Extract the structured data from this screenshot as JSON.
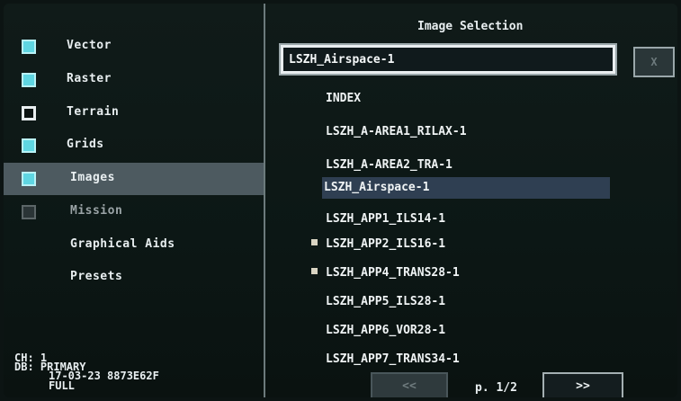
{
  "layers": [
    {
      "label": "Vector",
      "state": "on"
    },
    {
      "label": "Raster",
      "state": "on"
    },
    {
      "label": "Terrain",
      "state": "off"
    },
    {
      "label": "Grids",
      "state": "on"
    },
    {
      "label": "Images",
      "state": "on",
      "selected": true
    },
    {
      "label": "Mission",
      "state": "disabled"
    },
    {
      "label": "Graphical Aids"
    },
    {
      "label": "Presets"
    }
  ],
  "status": {
    "line1": "CH: 1",
    "line2": "DB: PRIMARY",
    "line3": "17-03-23 8873E62F",
    "line4": "FULL"
  },
  "image_selection": {
    "title": "Image Selection",
    "search_value": "LSZH_Airspace-1",
    "clear_label": "X",
    "items": [
      {
        "label": "INDEX"
      },
      {
        "label": "LSZH_A-AREA1_RILAX-1"
      },
      {
        "label": "LSZH_A-AREA2_TRA-1"
      },
      {
        "label": "LSZH_Airspace-1",
        "selected": true
      },
      {
        "label": "LSZH_APP1_ILS14-1"
      },
      {
        "label": "LSZH_APP2_ILS16-1",
        "expandable": true
      },
      {
        "label": "LSZH_APP4_TRANS28-1",
        "expandable": true
      },
      {
        "label": "LSZH_APP5_ILS28-1"
      },
      {
        "label": "LSZH_APP6_VOR28-1"
      },
      {
        "label": "LSZH_APP7_TRANS34-1"
      }
    ],
    "pager": {
      "prev_label": "<<",
      "page_text": "p. 1/2",
      "next_label": ">>"
    }
  }
}
